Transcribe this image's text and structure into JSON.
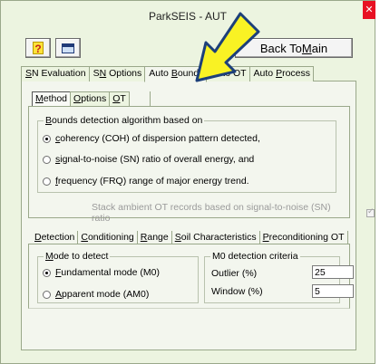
{
  "window": {
    "title": "ParkSEIS - AUT",
    "close_glyph": "✕"
  },
  "toolbar": {
    "help_glyph": "?",
    "back_label_prefix": "Back To ",
    "back_label_underlined": "M",
    "back_label_suffix": "ain"
  },
  "main_tabs": [
    {
      "pre": "",
      "ul": "S",
      "post": "N Evaluation"
    },
    {
      "pre": "S",
      "ul": "N",
      "post": " Options"
    },
    {
      "pre": "Auto ",
      "ul": "B",
      "post": "ounds"
    },
    {
      "pre": "Auto OT",
      "ul": "",
      "post": ""
    },
    {
      "pre": "Auto ",
      "ul": "P",
      "post": "rocess"
    }
  ],
  "sub_tabs": [
    {
      "pre": "",
      "ul": "M",
      "post": "ethod"
    },
    {
      "pre": "",
      "ul": "O",
      "post": "ptions"
    },
    {
      "pre": "",
      "ul": "O",
      "post": "T"
    }
  ],
  "bounds": {
    "label_ul": "B",
    "label_rest": "ounds detection algorithm based on",
    "options": [
      {
        "ul": "c",
        "rest": "oherency (COH) of dispersion pattern detected,",
        "selected": true
      },
      {
        "ul": "s",
        "rest": "ignal-to-noise (SN) ratio of overall energy, and",
        "selected": false
      },
      {
        "ul": "f",
        "rest": "requency (FRQ) range of major energy trend.",
        "selected": false
      }
    ],
    "stack_label": "Stack ambient OT records based on signal-to-noise (SN) ratio"
  },
  "lower_tabs": [
    {
      "pre": "",
      "ul": "D",
      "post": "etection"
    },
    {
      "pre": "",
      "ul": "C",
      "post": "onditioning"
    },
    {
      "pre": "",
      "ul": "R",
      "post": "ange"
    },
    {
      "pre": "",
      "ul": "S",
      "post": "oil Characteristics"
    },
    {
      "pre": "",
      "ul": "P",
      "post": "reconditioning OT"
    }
  ],
  "mode": {
    "label_ul": "M",
    "label_rest": "ode to detect",
    "options": [
      {
        "ul": "F",
        "rest": "undamental mode (M0)",
        "selected": true
      },
      {
        "ul": "A",
        "rest": "pparent mode (AM0)",
        "selected": false
      }
    ]
  },
  "m0": {
    "label": "M0 detection criteria",
    "outlier_label": "Outlier (%)",
    "outlier_value": "25",
    "window_label": "Window (%)",
    "window_value": "5"
  }
}
